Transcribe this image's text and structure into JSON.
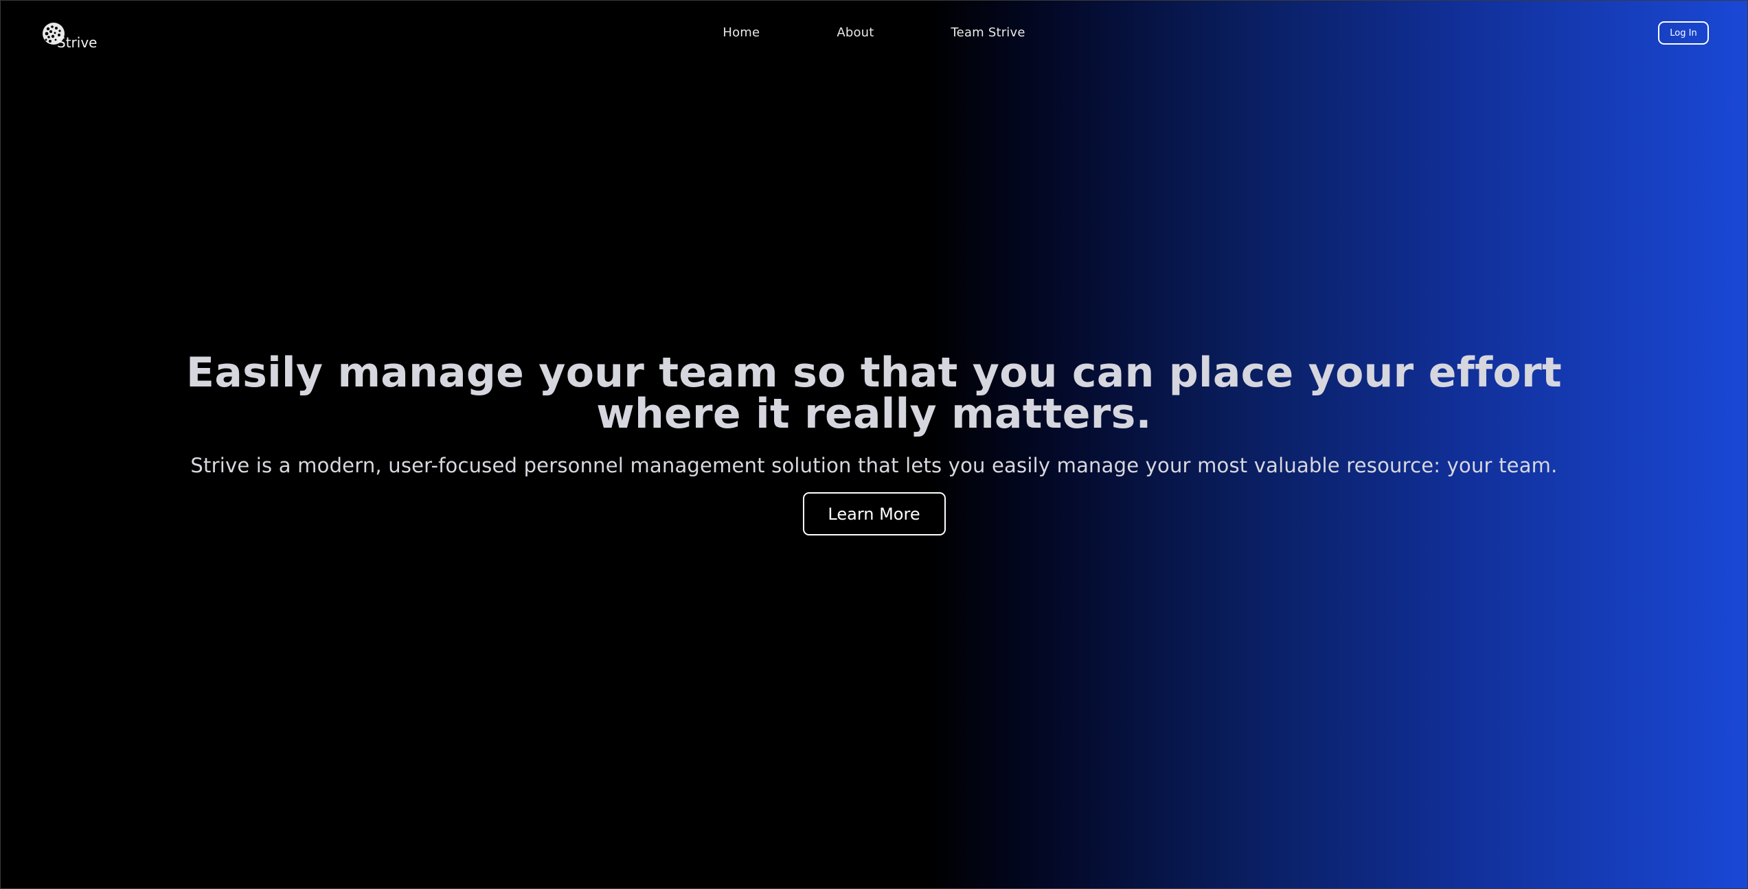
{
  "header": {
    "logo_text": "Strive",
    "logo_icon": "globe-icon",
    "nav": [
      {
        "label": "Home"
      },
      {
        "label": "About"
      },
      {
        "label": "Team Strive"
      }
    ],
    "login_label": "Log In"
  },
  "hero": {
    "title": "Easily manage your team so that you can place your effort where it really matters.",
    "subtitle": "Strive is a modern, user-focused personnel management solution that lets you easily manage your most valuable resource: your team.",
    "cta_label": "Learn More"
  },
  "colors": {
    "background_start": "#000000",
    "background_end": "#1a48d6",
    "title_text": "#d6d6de",
    "button_border": "#ffffff"
  }
}
